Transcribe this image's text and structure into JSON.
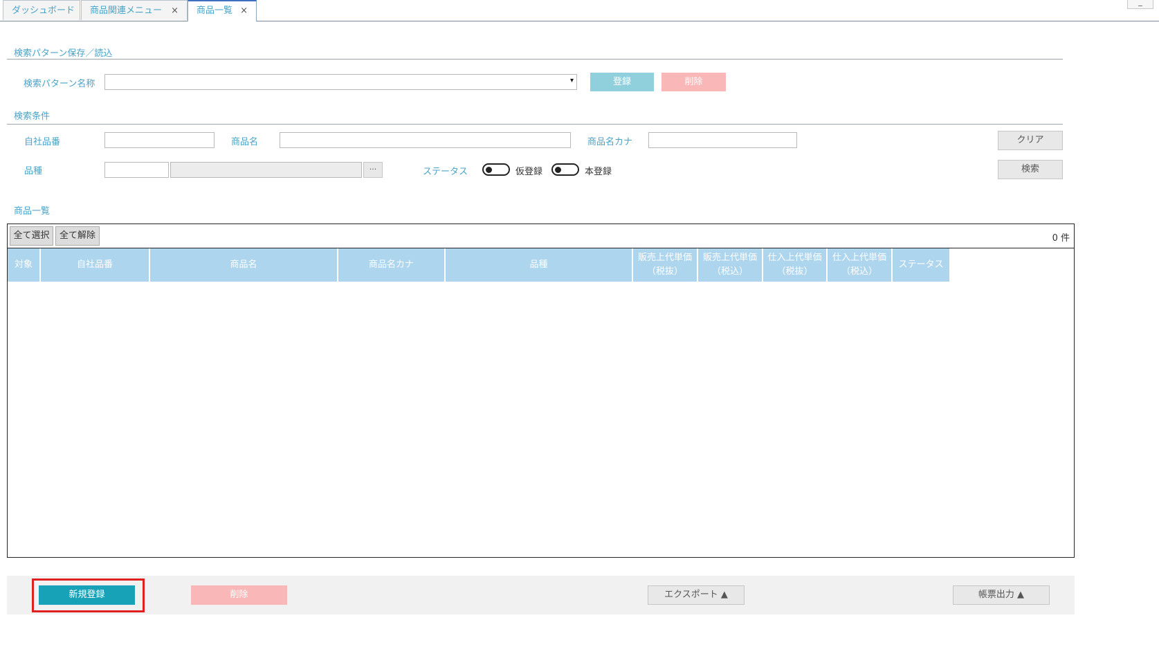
{
  "tabs": [
    {
      "label": "ダッシュボード",
      "closable": false
    },
    {
      "label": "商品関連メニュー",
      "closable": true
    },
    {
      "label": "商品一覧",
      "closable": true
    }
  ],
  "tab_close_glyph": "×",
  "minimize_glyph": "_",
  "pattern_section": {
    "title": "検索パターン保存／読込",
    "name_label": "検索パターン名称",
    "register_label": "登録",
    "delete_label": "削除"
  },
  "condition_section": {
    "title": "検索条件",
    "own_code_label": "自社品番",
    "product_name_label": "商品名",
    "product_kana_label": "商品名カナ",
    "category_label": "品種",
    "category_button": "···",
    "status_label": "ステータス",
    "status_options": [
      "仮登録",
      "本登録"
    ],
    "clear_label": "クリア",
    "search_label": "検索"
  },
  "list_section": {
    "title": "商品一覧",
    "select_all_label": "全て選択",
    "deselect_all_label": "全て解除",
    "count_text": "0 件",
    "columns": [
      [
        "対象"
      ],
      [
        "自社品番"
      ],
      [
        "商品名"
      ],
      [
        "商品名カナ"
      ],
      [
        "品種"
      ],
      [
        "販売上代単価",
        "（税抜）"
      ],
      [
        "販売上代単価",
        "（税込）"
      ],
      [
        "仕入上代単価",
        "（税抜）"
      ],
      [
        "仕入上代単価",
        "（税込）"
      ],
      [
        "ステータス"
      ]
    ],
    "rows": []
  },
  "footer": {
    "new_label": "新規登録",
    "delete_label": "削除",
    "export_label": "エクスポート ▲",
    "report_label": "帳票出力 ▲"
  },
  "colors": {
    "accent_text": "#4aa3c7",
    "header_bg": "#aed5ee",
    "primary_button": "#17a2b8",
    "danger_light": "#f9b7b7",
    "highlight_box": "#e0201f"
  }
}
